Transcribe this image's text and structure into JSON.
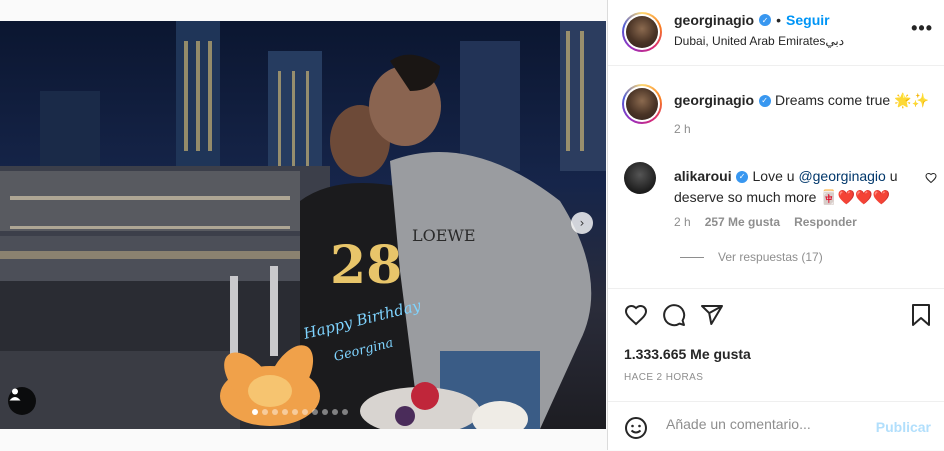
{
  "post": {
    "author": "georginagio",
    "follow_label": "Seguir",
    "location": "Dubai, United Arab Emiratesدبي",
    "more_label": "•••",
    "caption_text": "Dreams come true 🌟✨",
    "caption_time": "2 h",
    "cake_number": "28",
    "cake_line1": "Happy Birthday",
    "cake_line2": "Georgina",
    "brand_text": "LOEWE",
    "carousel_dots": 10,
    "carousel_active_index": 0
  },
  "comment": {
    "author": "alikaroui",
    "text_before": "Love u ",
    "mention": "@georginagio",
    "text_after": " u deserve so much more 🀄❤️❤️❤️",
    "time": "2 h",
    "likes": "257 Me gusta",
    "reply_label": "Responder",
    "view_replies": "Ver respuestas (17)"
  },
  "actions": {
    "likes_count": "1.333.665 Me gusta",
    "time_ago": "HACE 2 HORAS"
  },
  "add_comment": {
    "placeholder": "Añade un comentario...",
    "publish_label": "Publicar"
  },
  "colors": {
    "accent": "#0095f6",
    "verified": "#3897f0",
    "muted": "#8e8e8e",
    "publish_disabled": "#b2dffc"
  },
  "icons": [
    "user-tag-icon",
    "next-arrow-icon",
    "more-options-icon",
    "verified-icon",
    "heart-icon",
    "comment-icon",
    "share-icon",
    "bookmark-icon",
    "emoji-icon"
  ]
}
